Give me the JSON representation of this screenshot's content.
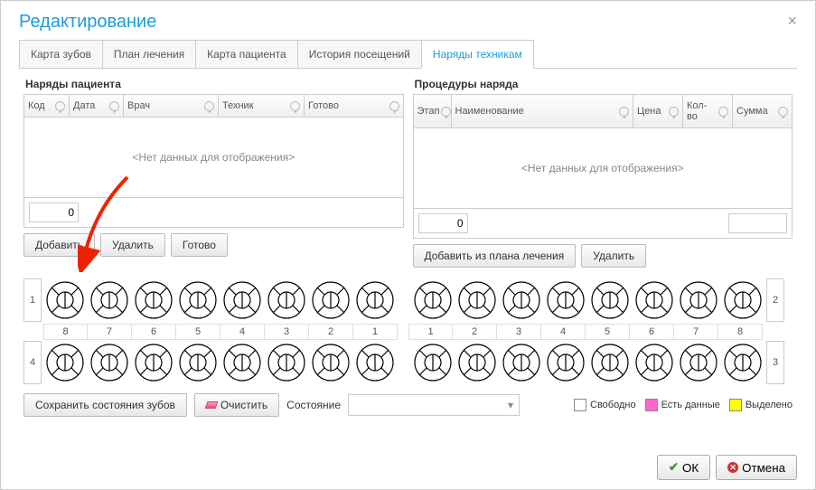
{
  "dialog": {
    "title": "Редактирование"
  },
  "tabs": [
    "Карта зубов",
    "План лечения",
    "Карта пациента",
    "История посещений",
    "Наряды техникам"
  ],
  "active_tab": 4,
  "left_panel": {
    "title": "Наряды пациента",
    "cols": [
      "Код",
      "Дата",
      "Врач",
      "Техник",
      "Готово"
    ],
    "empty": "<Нет данных для отображения>",
    "foot_value": "0",
    "buttons": [
      "Добавить",
      "Удалить",
      "Готово"
    ]
  },
  "right_panel": {
    "title": "Процедуры наряда",
    "cols": [
      "Этап",
      "Наименование",
      "Цена",
      "Кол-во",
      "Сумма"
    ],
    "empty": "<Нет данных для отображения>",
    "foot_value": "0",
    "buttons": [
      "Добавить из плана лечения",
      "Удалить"
    ]
  },
  "teeth": {
    "row_labels": [
      "1",
      "2",
      "4",
      "3"
    ],
    "top_nums_left": [
      "8",
      "7",
      "6",
      "5",
      "4",
      "3",
      "2",
      "1"
    ],
    "top_nums_right": [
      "1",
      "2",
      "3",
      "4",
      "5",
      "6",
      "7",
      "8"
    ]
  },
  "bottom": {
    "save_state": "Сохранить состояния зубов",
    "clear": "Очистить",
    "state_label": "Состояние",
    "legend": [
      {
        "label": "Свободно",
        "color": "#ffffff"
      },
      {
        "label": "Есть данные",
        "color": "#ff66cc"
      },
      {
        "label": "Выделено",
        "color": "#ffff00"
      }
    ]
  },
  "footer": {
    "ok": "ОК",
    "cancel": "Отмена"
  }
}
